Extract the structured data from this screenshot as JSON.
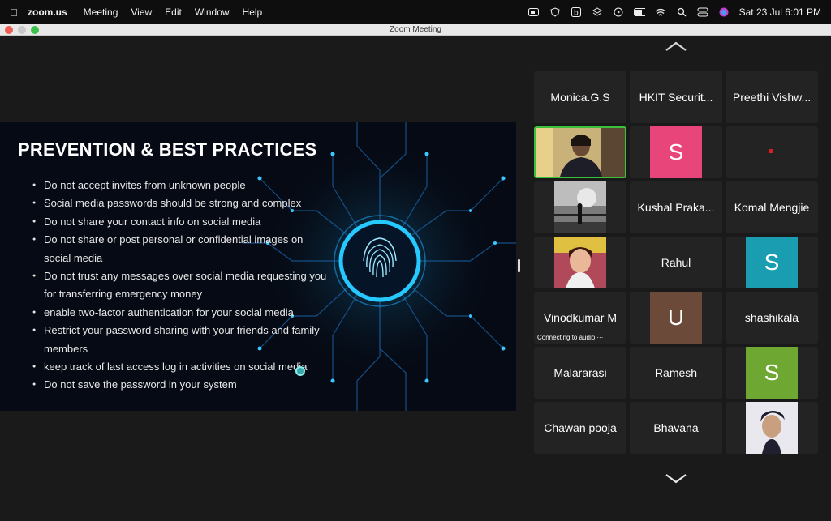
{
  "menubar": {
    "app": "zoom.us",
    "items": [
      "Meeting",
      "View",
      "Edit",
      "Window",
      "Help"
    ],
    "clock": "Sat 23 Jul  6:01 PM"
  },
  "window": {
    "title": "Zoom Meeting"
  },
  "slide": {
    "title": "PREVENTION & BEST PRACTICES",
    "bullets": [
      "Do not accept invites from unknown people",
      "Social media passwords should be strong and complex",
      "Do not share your contact info on social media",
      "Do not share or post personal or confidential images on social media",
      "Do not trust any messages over social media requesting you for transferring emergency money",
      "enable two-factor authentication for your social media",
      "Restrict your password sharing with your friends and family members",
      "keep track of last access log in activities on social media",
      "Do not save the password in your system"
    ]
  },
  "participants": [
    {
      "name": "Monica.G.S"
    },
    {
      "name": "HKIT Securit..."
    },
    {
      "name": "Preethi Vishw..."
    },
    {
      "name": "",
      "video": "woman-video"
    },
    {
      "name": "",
      "avatar": "S",
      "color": "#e8457a"
    },
    {
      "name": "",
      "marker": "red-dot"
    },
    {
      "name": "",
      "photo": "silhouette-photo"
    },
    {
      "name": "Kushal Praka..."
    },
    {
      "name": "Komal Mengjie"
    },
    {
      "name": "",
      "photo": "woman-photo"
    },
    {
      "name": "Rahul"
    },
    {
      "name": "",
      "avatar": "S",
      "color": "#1a9db0"
    },
    {
      "name": "Vinodkumar M",
      "status": "Connecting to audio  ···"
    },
    {
      "name": "",
      "avatar": "U",
      "color": "#6b4a3a"
    },
    {
      "name": "shashikala"
    },
    {
      "name": "Malararasi"
    },
    {
      "name": "Ramesh"
    },
    {
      "name": "",
      "avatar": "S",
      "color": "#6ea832"
    },
    {
      "name": "Chawan pooja"
    },
    {
      "name": "Bhavana"
    },
    {
      "name": "",
      "photo": "man-photo"
    }
  ]
}
